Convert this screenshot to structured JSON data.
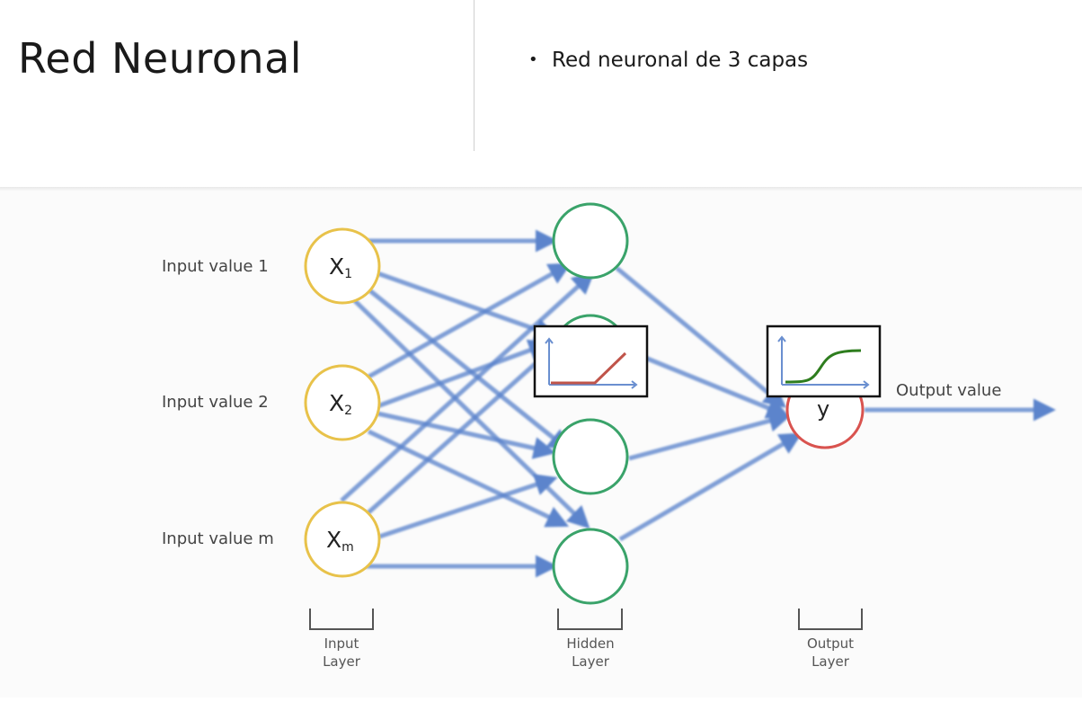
{
  "slide": {
    "title": "Red Neuronal",
    "bullets": [
      "Red neuronal de 3 capas"
    ]
  },
  "diagram": {
    "inputs": [
      {
        "label": "Input value 1",
        "node": "X",
        "sub": "1"
      },
      {
        "label": "Input value 2",
        "node": "X",
        "sub": "2"
      },
      {
        "label": "Input value m",
        "node": "X",
        "sub": "m"
      }
    ],
    "output_node": "y",
    "output_label": "Output value",
    "layers": {
      "input": [
        "Input",
        "Layer"
      ],
      "hidden": [
        "Hidden",
        "Layer"
      ],
      "output": [
        "Output",
        "Layer"
      ]
    },
    "colors": {
      "input_node": "#e8c24a",
      "hidden_node": "#3aa36a",
      "output_node": "#d9534f",
      "arrow": "#5b84cc",
      "relu": "#c0544a",
      "sigmoid": "#2e7d1e",
      "axes": "#6a8fd0"
    },
    "activation_icons": [
      "relu-activation",
      "sigmoid-activation"
    ]
  }
}
